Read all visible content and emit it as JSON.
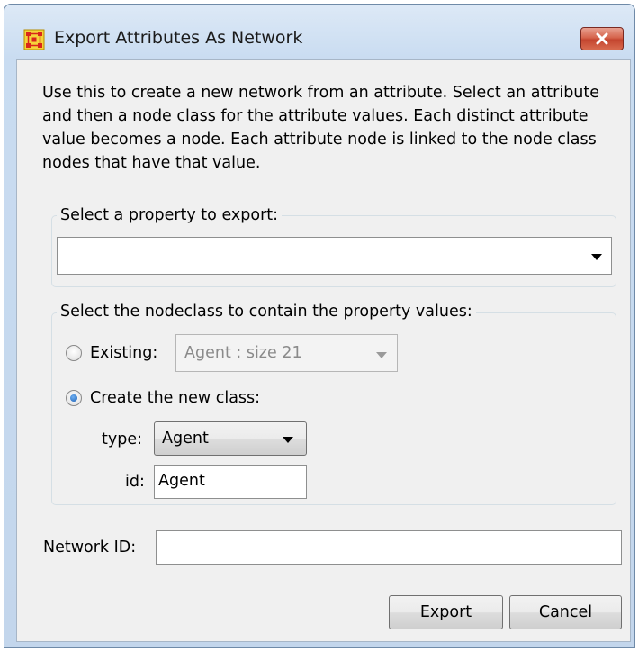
{
  "window": {
    "title": "Export Attributes As Network",
    "close_icon": "close-icon",
    "app_icon": "network-grid-icon",
    "accent_color": "#c4452f"
  },
  "description": "Use this to create a new network from an attribute. Select an attribute and then a node class for the attribute values. Each distinct attribute value becomes a node. Each attribute node is linked to the node class nodes that have that value.",
  "property_group": {
    "legend": "Select a property to export:",
    "selected_value": ""
  },
  "nodeclass_group": {
    "legend": "Select the nodeclass to contain the property values:",
    "existing_label": "Existing:",
    "existing_value": "Agent : size 21",
    "existing_selected": false,
    "create_label": "Create the new class:",
    "create_selected": true,
    "type_label": "type:",
    "type_value": "Agent",
    "id_label": "id:",
    "id_value": "Agent"
  },
  "network_id": {
    "label": "Network ID:",
    "value": ""
  },
  "buttons": {
    "export_label": "Export",
    "cancel_label": "Cancel"
  }
}
